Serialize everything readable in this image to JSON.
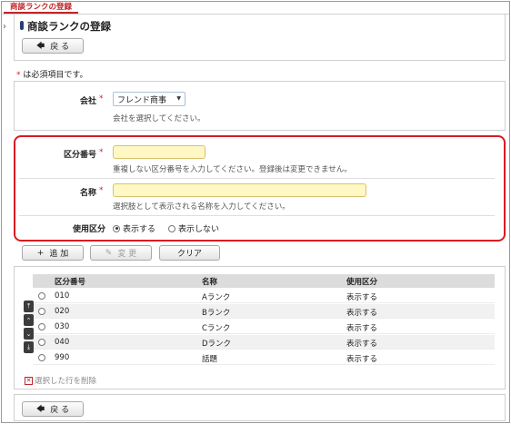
{
  "tab": {
    "label": "商談ランクの登録"
  },
  "header": {
    "title": "商談ランクの登録",
    "back_label": "戻 る"
  },
  "required_note": {
    "mark": "*",
    "text": " は必須項目です。"
  },
  "company": {
    "label": "会社",
    "required": "*",
    "value": "フレンド商事",
    "hint": "会社を選択してください。"
  },
  "form": {
    "code": {
      "label": "区分番号",
      "required": "*",
      "value": "",
      "hint": "重複しない区分番号を入力してください。登録後は変更できません。"
    },
    "name": {
      "label": "名称",
      "required": "*",
      "value": "",
      "hint": "選択肢として表示される名称を入力してください。"
    },
    "usage": {
      "label": "使用区分",
      "options": [
        "表示する",
        "表示しない"
      ],
      "selected": "表示する"
    }
  },
  "actions": {
    "add": "追 加",
    "change": "変 更",
    "clear": "クリア"
  },
  "table": {
    "columns": [
      "区分番号",
      "名称",
      "使用区分"
    ],
    "rows": [
      {
        "code": "010",
        "name": "Aランク",
        "usage": "表示する"
      },
      {
        "code": "020",
        "name": "Bランク",
        "usage": "表示する"
      },
      {
        "code": "030",
        "name": "Cランク",
        "usage": "表示する"
      },
      {
        "code": "040",
        "name": "Dランク",
        "usage": "表示する"
      },
      {
        "code": "990",
        "name": "話題",
        "usage": "表示する"
      }
    ],
    "delete_label": "選択した行を削除"
  },
  "footer": {
    "back_label": "戻 る"
  },
  "colors": {
    "accent": "#c02428",
    "required_frame": "#d81b22",
    "input_bg": "#fff7c4"
  }
}
